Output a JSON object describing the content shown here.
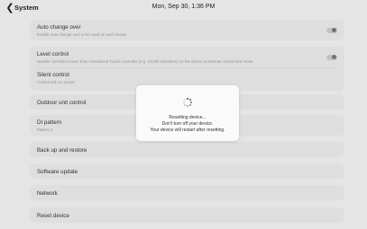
{
  "header": {
    "back_icon": "chevron-left-icon",
    "title": "System",
    "datetime": "Mon, Sep 30, 1:36 PM"
  },
  "settings": {
    "auto_change_over": {
      "title": "Auto change over",
      "subtitle": "Enable Auto change over to be used on each device",
      "toggle_on": false
    },
    "level_control": {
      "title": "Level control",
      "subtitle": "Disable controllers lower than Centralized Touch Controller (e.g. On/off controllers) on the device in Remote control lock mode.",
      "toggle_on": false
    },
    "silent_control": {
      "title": "Silent control",
      "subtitle": "Control with no sound."
    },
    "outdoor_unit_control": {
      "title": "Outdoor unit control"
    },
    "di_pattern": {
      "title": "DI pattern",
      "subtitle": "Pattern 1"
    },
    "backup_restore": {
      "title": "Back up and restore"
    },
    "software_update": {
      "title": "Software update"
    },
    "network": {
      "title": "Network"
    },
    "reset_device": {
      "title": "Reset device"
    }
  },
  "dialog": {
    "spinner_icon": "loading-spinner-icon",
    "line1": "Resetting device...",
    "line2": "Don't turn off your device.",
    "line3": "Your device will restart after resetting."
  },
  "colors": {
    "background": "#efefef",
    "card": "#e8e8e8",
    "dialog": "#fafafa"
  }
}
